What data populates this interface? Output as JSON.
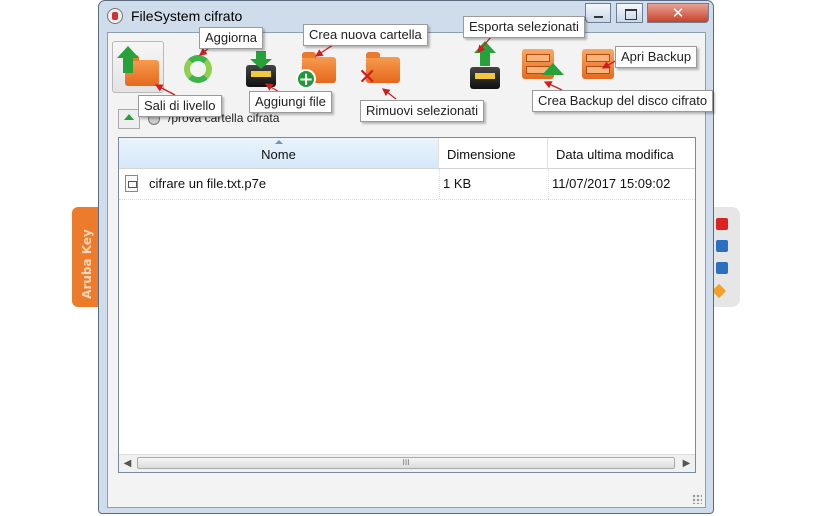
{
  "window": {
    "title": "FileSystem cifrato",
    "close_glyph": "✕"
  },
  "background_widget": {
    "label": "Aruba Key"
  },
  "toolbar": {
    "buttons": [
      {
        "name": "sali-di-livello",
        "icon": "folder-up-arrow-icon"
      },
      {
        "name": "aggiorna",
        "icon": "refresh-icon"
      },
      {
        "name": "aggiungi-file",
        "icon": "add-file-icon"
      },
      {
        "name": "crea-nuova-cartella",
        "icon": "new-folder-icon"
      },
      {
        "name": "rimuovi-selezionati",
        "icon": "delete-icon"
      },
      {
        "name": "esporta-selezionati",
        "icon": "export-icon"
      },
      {
        "name": "crea-backup",
        "icon": "backup-icon"
      },
      {
        "name": "apri-backup",
        "icon": "open-backup-icon"
      }
    ]
  },
  "address": {
    "path": "/prova cartella cifrata"
  },
  "list": {
    "columns": [
      "Nome",
      "Dimensione",
      "Data ultima modifica"
    ],
    "rows": [
      {
        "name": "cifrare un file.txt.p7e",
        "size": "1 KB",
        "modified": "11/07/2017 15:09:02"
      }
    ],
    "scroll_thumb": "III"
  },
  "callouts": {
    "aggiorna": "Aggiorna",
    "crea_nuova_cartella": "Crea nuova cartella",
    "esporta_selezionati": "Esporta selezionati",
    "apri_backup": "Apri Backup",
    "sali_di_livello": "Sali di livello",
    "aggiungi_file": "Aggiungi file",
    "rimuovi_selezionati": "Rimuovi selezionati",
    "crea_backup": "Crea Backup del disco cifrato"
  },
  "colors": {
    "callout_arrow": "#d21d1d",
    "folder_orange": "#e97a2c",
    "arrow_green": "#27a13a"
  }
}
